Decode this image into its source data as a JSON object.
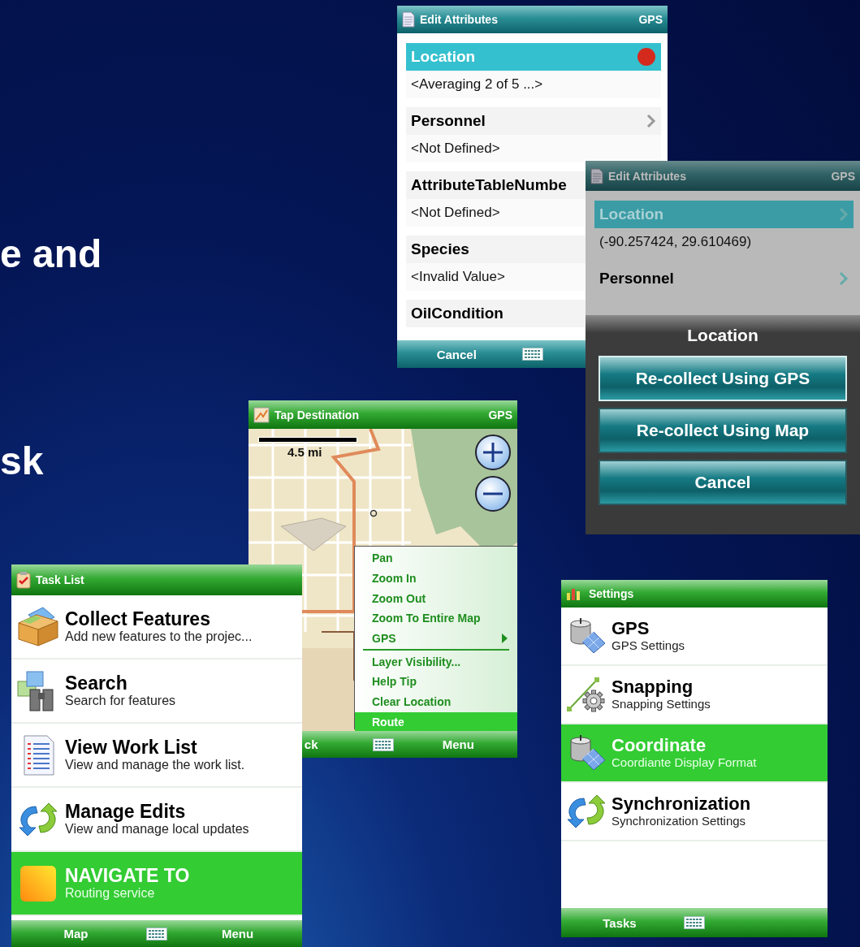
{
  "slide_lines": [
    "e and",
    "sk"
  ],
  "edit_attributes": {
    "title": "Edit Attributes",
    "title_right": "GPS",
    "fields": [
      {
        "label": "Location",
        "value": "<Averaging 2 of 5 ...>",
        "selected": true,
        "kind": "recording"
      },
      {
        "label": "Personnel",
        "value": "<Not Defined>",
        "selected": false,
        "kind": "link"
      },
      {
        "label": "AttributeTableNumbe",
        "value": "<Not Defined>",
        "selected": false,
        "kind": "plain"
      },
      {
        "label": "Species",
        "value": "<Invalid Value>",
        "selected": false,
        "kind": "plain"
      },
      {
        "label": "OilCondition",
        "selected": false,
        "kind": "plain"
      }
    ],
    "softkeys": {
      "left": "Cancel"
    }
  },
  "location_dialog_screen": {
    "title": "Edit Attributes",
    "title_right": "GPS",
    "dimmed": true,
    "fields": [
      {
        "label": "Location",
        "value": "(-90.257424, 29.610469)",
        "selected": true,
        "kind": "link"
      },
      {
        "label": "Personnel",
        "selected": false,
        "kind": "link"
      }
    ],
    "dialog": {
      "title": "Location",
      "buttons": [
        {
          "label": "Re-collect Using GPS",
          "selected": true
        },
        {
          "label": "Re-collect Using Map",
          "selected": false
        },
        {
          "label": "Cancel",
          "selected": false
        }
      ]
    }
  },
  "tap_destination": {
    "title": "Tap Destination",
    "title_right": "GPS",
    "scale": "4.5 mi",
    "menu": [
      {
        "kind": "item",
        "label": "Pan",
        "selected": false
      },
      {
        "kind": "item",
        "label": "Zoom In",
        "selected": false
      },
      {
        "kind": "item",
        "label": "Zoom Out",
        "selected": false
      },
      {
        "kind": "item",
        "label": "Zoom To Entire Map",
        "selected": false
      },
      {
        "kind": "submenu",
        "label": "GPS",
        "selected": false
      },
      {
        "kind": "separator"
      },
      {
        "kind": "item",
        "label": "Layer Visibility...",
        "selected": false
      },
      {
        "kind": "item",
        "label": "Help Tip",
        "selected": false
      },
      {
        "kind": "item",
        "label": "Clear Location",
        "selected": false
      },
      {
        "kind": "item",
        "label": "Route",
        "selected": true
      }
    ],
    "softkeys": {
      "left": "ck",
      "right": "Menu"
    }
  },
  "task_list": {
    "title": "Task List",
    "items": [
      {
        "kind": "collect",
        "title": "Collect Features",
        "subtitle": "Add new features to the projec...",
        "selected": false
      },
      {
        "kind": "search",
        "title": "Search",
        "subtitle": "Search for features",
        "selected": false
      },
      {
        "kind": "worklist",
        "title": "View Work List",
        "subtitle": "View and manage the work list.",
        "selected": false
      },
      {
        "kind": "sync",
        "title": "Manage Edits",
        "subtitle": "View and manage local updates",
        "selected": false
      },
      {
        "kind": "navigate",
        "title": "NAVIGATE TO",
        "subtitle": "Routing service",
        "selected": true
      }
    ],
    "softkeys": {
      "left": "Map",
      "right": "Menu"
    }
  },
  "settings": {
    "title": "Settings",
    "items": [
      {
        "kind": "gps",
        "title": "GPS",
        "subtitle": "GPS Settings",
        "selected": false
      },
      {
        "kind": "snapping",
        "title": "Snapping",
        "subtitle": "Snapping Settings",
        "selected": false
      },
      {
        "kind": "gps",
        "title": "Coordinate",
        "subtitle": "Coordiante Display Format",
        "selected": true
      },
      {
        "kind": "sync",
        "title": "Synchronization",
        "subtitle": "Synchronization Settings",
        "selected": false
      }
    ],
    "softkeys": {
      "left": "Tasks"
    }
  }
}
